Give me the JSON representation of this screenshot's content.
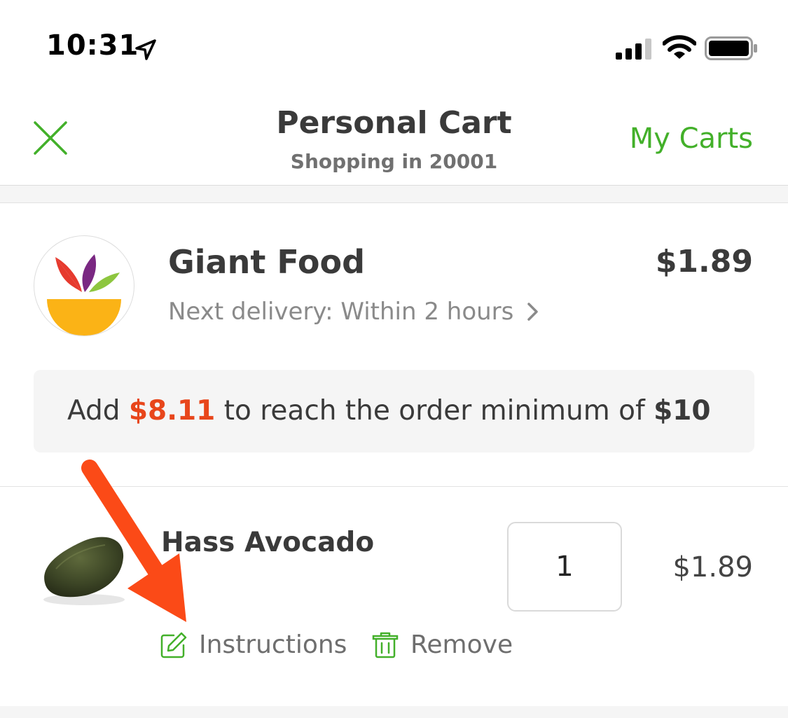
{
  "status_bar": {
    "time": "10:31"
  },
  "nav": {
    "title": "Personal Cart",
    "subtitle": "Shopping in 20001",
    "my_carts_label": "My Carts",
    "close_icon": "close-x-icon"
  },
  "store": {
    "name": "Giant Food",
    "total": "$1.89",
    "delivery_text": "Next delivery: Within 2 hours",
    "logo_icon": "giant-food-logo"
  },
  "order_minimum": {
    "prefix": "Add",
    "amount": "$8.11",
    "middle": "to reach the order minimum of",
    "minimum": "$10"
  },
  "items": [
    {
      "name": "Hass Avocado",
      "quantity": "1",
      "price": "$1.89",
      "instructions_label": "Instructions",
      "remove_label": "Remove"
    }
  ],
  "colors": {
    "accent_green": "#43b02a",
    "highlight_orange": "#e8461b",
    "annotation_arrow": "#fb4a17"
  }
}
